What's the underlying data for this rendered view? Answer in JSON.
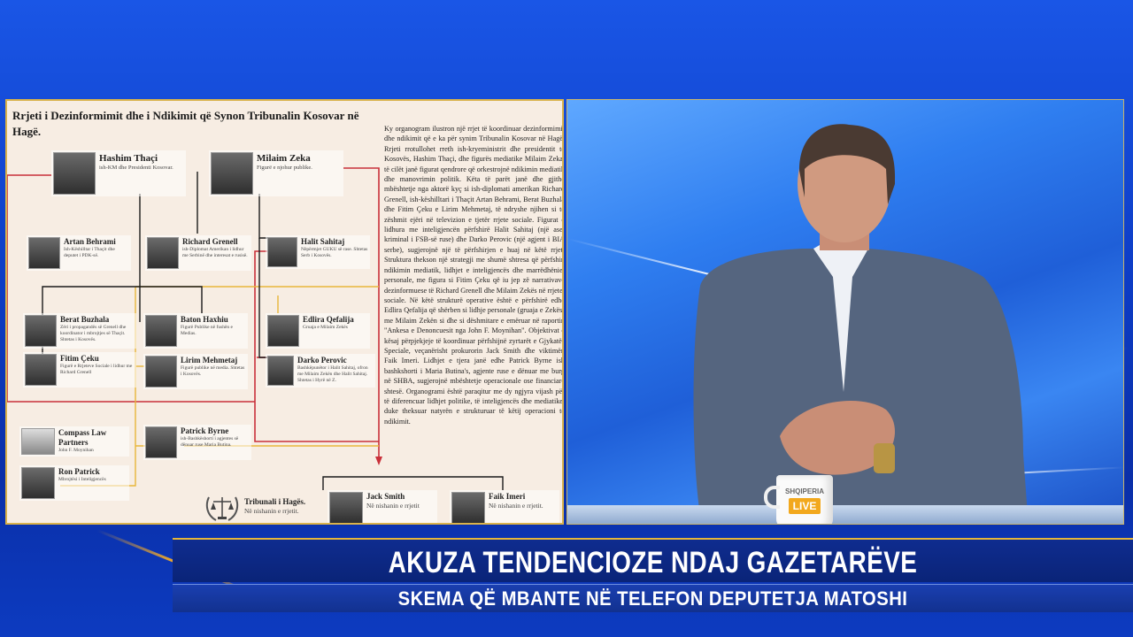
{
  "document": {
    "title": "Rrjeti i Dezinformimit dhe i Ndikimit që Synon Tribunalin Kosovar në Hagë.",
    "nodes": [
      {
        "name": "Hashim Thaçi",
        "desc": "ish-KM dhe Presidenti Kosovar."
      },
      {
        "name": "Milaim Zeka",
        "desc": "Figurë e njohur publike."
      },
      {
        "name": "Artan Behrami",
        "desc": "Ish-Këshilltar i Thaçit dhe deputet i PDK-së."
      },
      {
        "name": "Richard Grenell",
        "desc": "ish-Diplomat Amerikan i lidhur me Serbinë dhe interesat e rusisë."
      },
      {
        "name": "Halit Sahitaj",
        "desc": "Nëpërmjet GUKU së rase. Shtetas Serb i Kosovës."
      },
      {
        "name": "Berat Buzhala",
        "desc": "Zëri i propagandës së Grenell dhe koordinator i mbrojtjes së Thaçit. Shtetas i Kosovës."
      },
      {
        "name": "Baton Haxhiu",
        "desc": "Figurë Publike në fushën e Medias."
      },
      {
        "name": "Edlira Qefalija",
        "desc": "Gruaja e Milaim Zekës"
      },
      {
        "name": "Fitim Çeku",
        "desc": "Figurë e Rrjeteve Sociale i lidhur me Richard Grenell"
      },
      {
        "name": "Lirim Mehmetaj",
        "desc": "Figurë publike në media. Shtetas i Kosovës."
      },
      {
        "name": "Darko Perovic",
        "desc": "Bashkëpunëtor i Halit Sahitaj, ofron me Milaim Zekën dhe Halit Sahitaj. Shtetas i Hyrë në Z."
      },
      {
        "name": "Compass Law Partners",
        "desc": "John F. Moynihan"
      },
      {
        "name": "Patrick Byrne",
        "desc": "ish-Bashkëshorti i agjentes së dënuar ruse Maria Butina."
      },
      {
        "name": "Ron Patrick",
        "desc": "Mbrojtësi i Inteligjencës"
      },
      {
        "name": "Tribunali i Hagës.",
        "desc": "Në nishanin e rrjetit."
      },
      {
        "name": "Jack Smith",
        "desc": "Në nishanin e rrjetit"
      },
      {
        "name": "Faik Imeri",
        "desc": "Në nishanin e rrjetit."
      }
    ],
    "body_text": "Ky organogram ilustron një rrjet të koordinuar dezinformimit dhe ndikimit që e ka për synim Tribunalin Kosovar në Hagë. Rrjeti rrotullohet rreth ish-kryeministrit dhe presidentit të Kosovës, Hashim Thaçi, dhe figurës mediatike Milaim Zeka, të cilët janë figurat qendrore që orkestrojnë ndikimin mediatik dhe manovrimin politik. Këta të parët janë dhe gjithë mbështetje nga aktorë kyç si ish-diplomati amerikan Richard Grenell, ish-këshilltari i Thaçit Artan Behrami, Berat Buzhala dhe Fitim Çeku e Lirim Mehmetaj, të ndryshe njihen si të zëshmit ejëri në televizion e tjetër rrjete sociale. Figurat e lidhura me inteligjencën përfshirë Halit Sahitaj (një aset kriminal i FSB-së ruse) dhe Darko Perovic (një agjent i BIA serbe), sugjerojnë një të përfshirjen e huaj në këtë rrjet. Struktura thekson një strategji me shumë shtresa që përfshin ndikimin mediatik, lidhjet e inteligjencës dhe marrëdhëniet personale, me figura si Fitim Çeku që iu jep zë narrativave dezinformuese të Richard Grenell dhe Milaim Zekës në rrjetet sociale. Në këtë strukturë operative është e përfshirë edhe Edlira Qefalija që shërben si lidhje personale (gruaja e Zekës) me Milaim Zekën si dhe si dëshmitare e emëruar në raportin \"Ankesa e Denoncuesit nga John F. Moynihan\". Objektivat e kësaj përpjekjeje të koordinuar përfshijnë zyrtarët e Gjykatës Speciale, veçanërisht prokurorin Jack Smith dhe viktimën Faik Imeri. Lidhjet e tjera janë edhe Patrick Byrne ish bashkshorti i Maria Butina's, agjente ruse e dënuar me burg në SHBA, sugjerojnë mbështetje operacionale ose financiare shtesë. Organogrami është paraqitur me dy ngjyra vijash për të diferencuar lidhjet politike, të inteligjencës dhe mediatike, duke theksuar natyrën e strukturuar të këtij operacioni të ndikimit."
  },
  "studio": {
    "mug_logo": "SHQIPERIA",
    "mug_live": "LIVE"
  },
  "lower_third": {
    "headline": "AKUZA TENDENCIOZE NDAJ GAZETARËVE",
    "subline": "SKEMA QË MBANTE NË TELEFON DEPUTETJA MATOSHI"
  },
  "colors": {
    "link_red": "#c9303a",
    "link_yellow": "#e8b63a",
    "link_black": "#1a1a1a",
    "accent_gold": "#e3b53c",
    "bar_blue": "#0f2c8f"
  }
}
